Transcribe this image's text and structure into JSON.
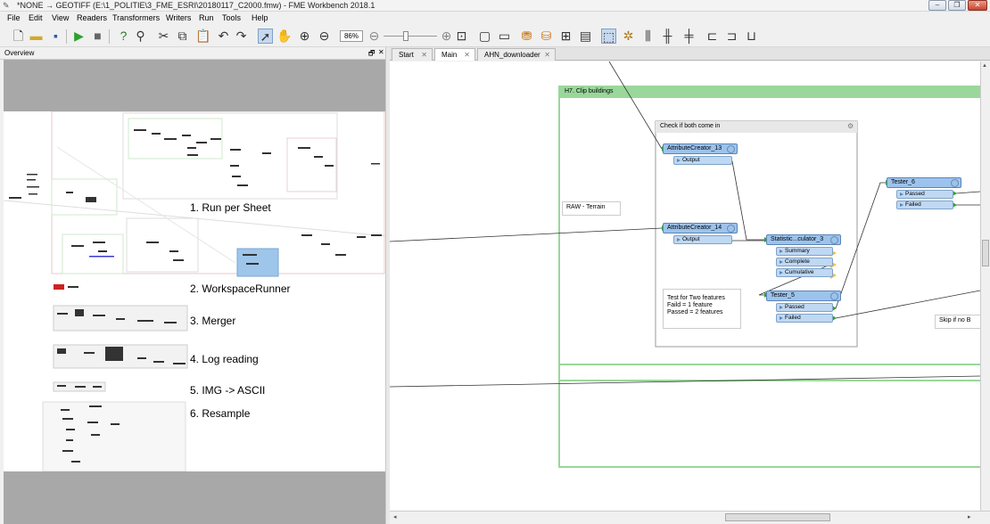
{
  "window": {
    "title": "*NONE → GEOTIFF (E:\\1_POLITIE\\3_FME_ESRI\\20180117_C2000.fmw) - FME Workbench 2018.1",
    "minimize_glyph": "–",
    "maximize_glyph": "❐",
    "close_glyph": "✕"
  },
  "menu": [
    "File",
    "Edit",
    "View",
    "Readers",
    "Transformers",
    "Writers",
    "Run",
    "Tools",
    "Help"
  ],
  "toolbar": {
    "zoom_value": "86%",
    "icons": [
      "new-icon",
      "open-icon",
      "save-icon",
      "run-icon",
      "stop-icon",
      "inspect-icon",
      "find-icon",
      "cut-icon",
      "copy-icon",
      "paste-icon",
      "undo-icon",
      "redo-icon",
      "select-icon",
      "pan-icon",
      "zoom-in-icon",
      "zoom-out-icon"
    ]
  },
  "overview": {
    "title": "Overview",
    "float_glyph": "🗗",
    "close_glyph": "✕",
    "labels": [
      "1. Run per Sheet",
      "2. WorkspaceRunner",
      "3. Merger",
      "4. Log reading",
      "5. IMG -> ASCII",
      "6. Resample"
    ]
  },
  "tabs": [
    {
      "label": "Start"
    },
    {
      "label": "Main"
    },
    {
      "label": "AHN_downloader"
    }
  ],
  "tab_close_glyph": "✕",
  "canvas": {
    "bookmark_clip": "H7. Clip buildings",
    "bookmark_check": "Check if both come in",
    "raw_note": "RAW - Terrain",
    "test_note": [
      "Test for Two features",
      "Faild = 1 feature",
      "Passed = 2 features"
    ],
    "skip_note": "Skip if no B",
    "transformers": {
      "ac13": {
        "name": "AttributeCreator_13",
        "ports": [
          "Output"
        ]
      },
      "ac14": {
        "name": "AttributeCreator_14",
        "ports": [
          "Output"
        ]
      },
      "stat": {
        "name": "Statistic...culator_3",
        "ports": [
          "Summary",
          "Complete",
          "Cumulative"
        ]
      },
      "tester5": {
        "name": "Tester_5",
        "ports": [
          "Passed",
          "Failed"
        ]
      },
      "tester6": {
        "name": "Tester_6",
        "ports": [
          "Passed",
          "Failed"
        ]
      }
    },
    "gear_glyph": "⚙"
  },
  "colors": {
    "transformer": "#9cc3ec",
    "bookmark_green": "#9ad79a",
    "bookmark_gray": "#e8e8e8",
    "run_green": "#2ea12e"
  }
}
